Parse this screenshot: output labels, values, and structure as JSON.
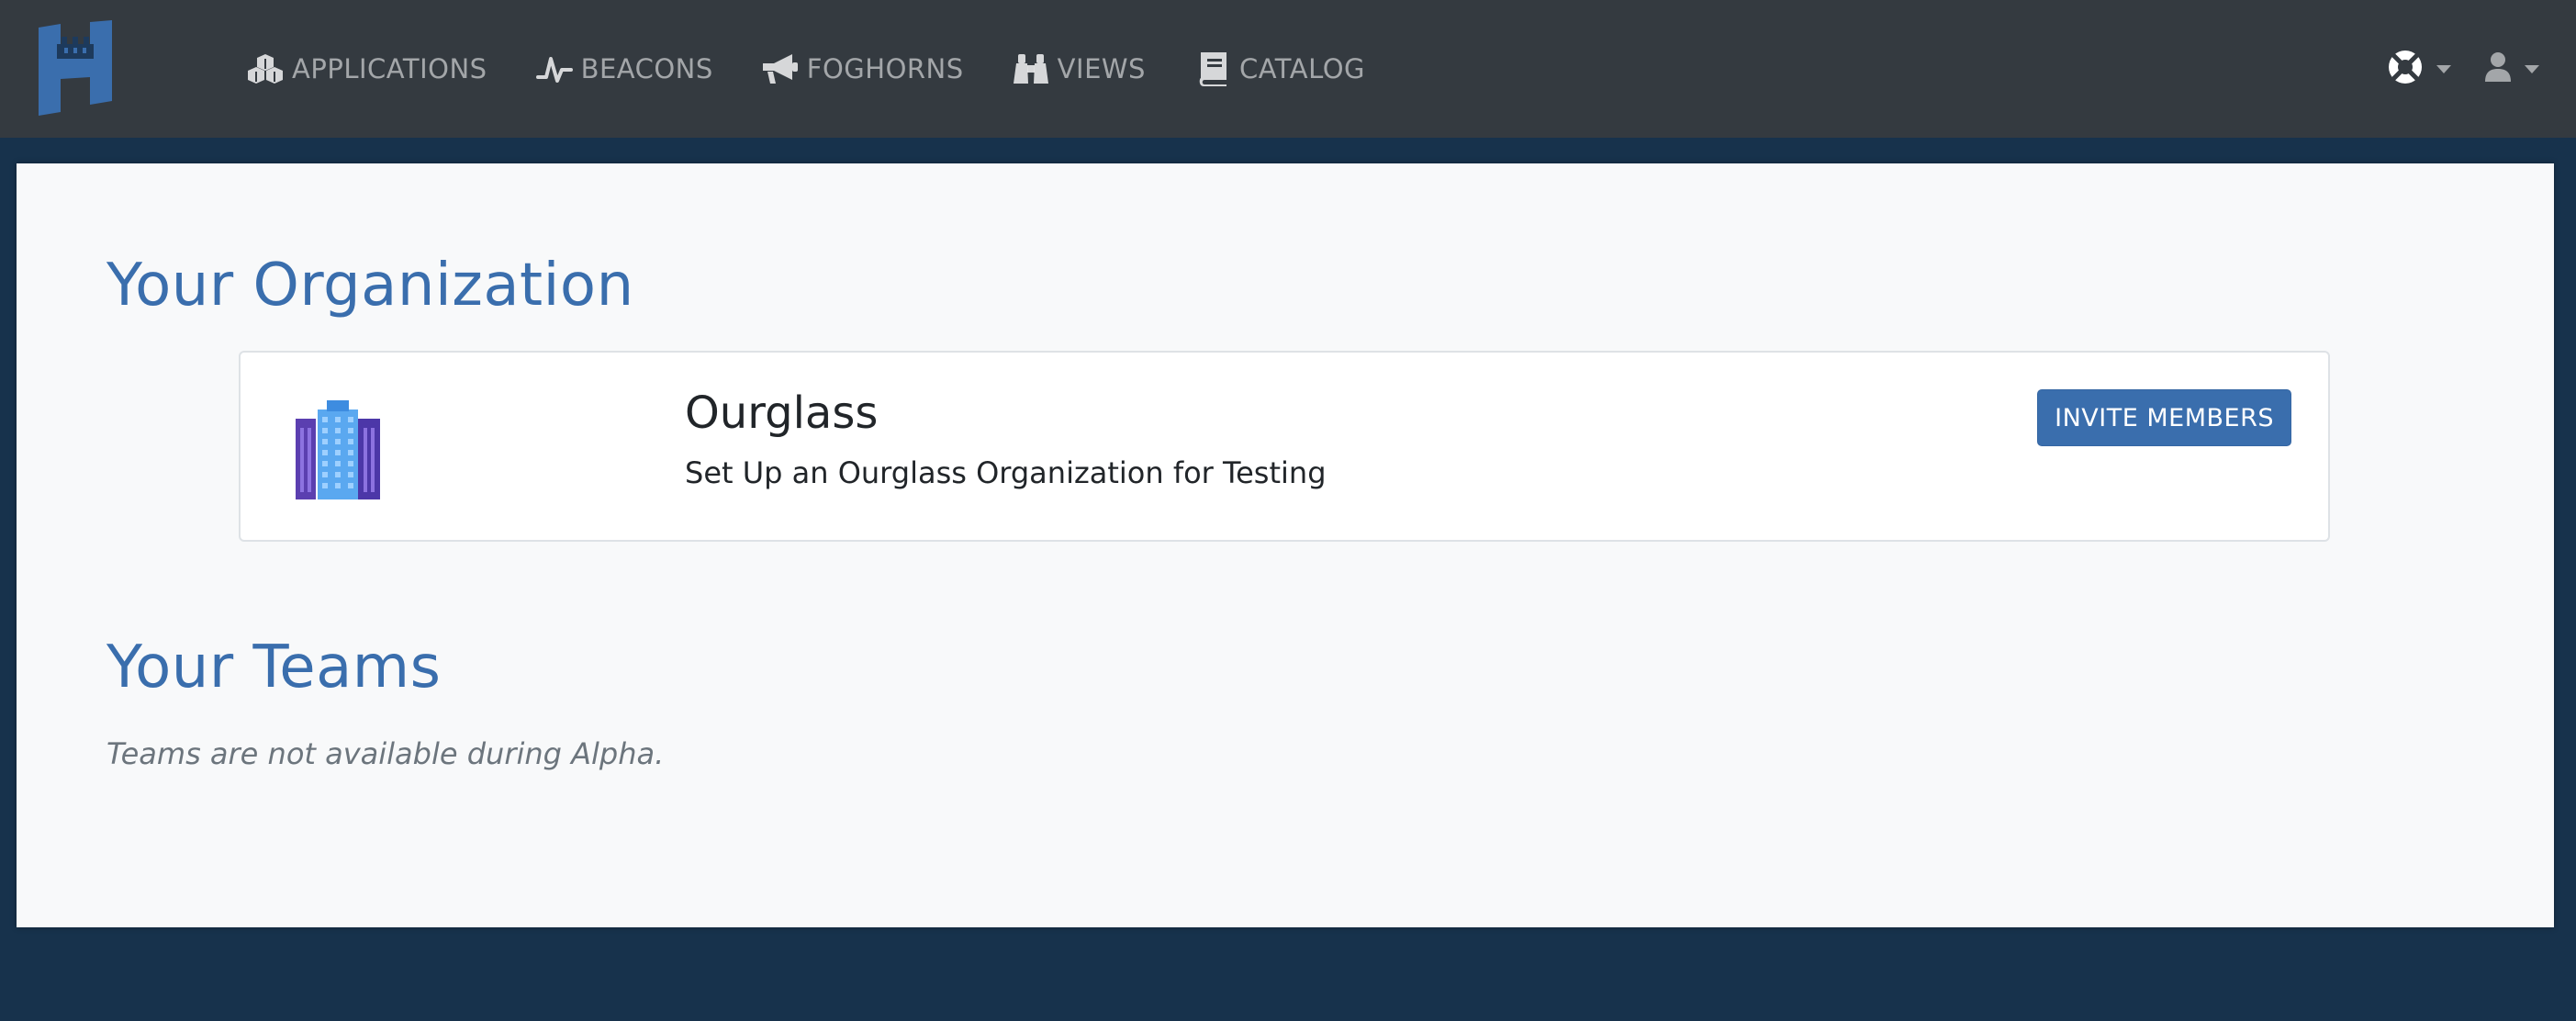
{
  "navbar": {
    "brand_icon": "castle-logo",
    "items": [
      {
        "icon": "cubes-icon",
        "label": "APPLICATIONS"
      },
      {
        "icon": "heartbeat-icon",
        "label": "BEACONS"
      },
      {
        "icon": "bullhorn-icon",
        "label": "FOGHORNS"
      },
      {
        "icon": "binoculars-icon",
        "label": "VIEWS"
      },
      {
        "icon": "book-icon",
        "label": "CATALOG"
      }
    ],
    "help_icon": "life-ring-icon",
    "user_icon": "user-icon"
  },
  "organization": {
    "section_title": "Your Organization",
    "logo_icon": "office-building-icon",
    "name": "Ourglass",
    "description": "Set Up an Ourglass Organization for Testing",
    "invite_label": "INVITE MEMBERS"
  },
  "teams": {
    "section_title": "Your Teams",
    "note": "Teams are not available during Alpha."
  },
  "colors": {
    "page_background": "#17324c",
    "navbar_background": "#343a40",
    "accent": "#3a6ead",
    "content_background": "#f8f9fa"
  }
}
